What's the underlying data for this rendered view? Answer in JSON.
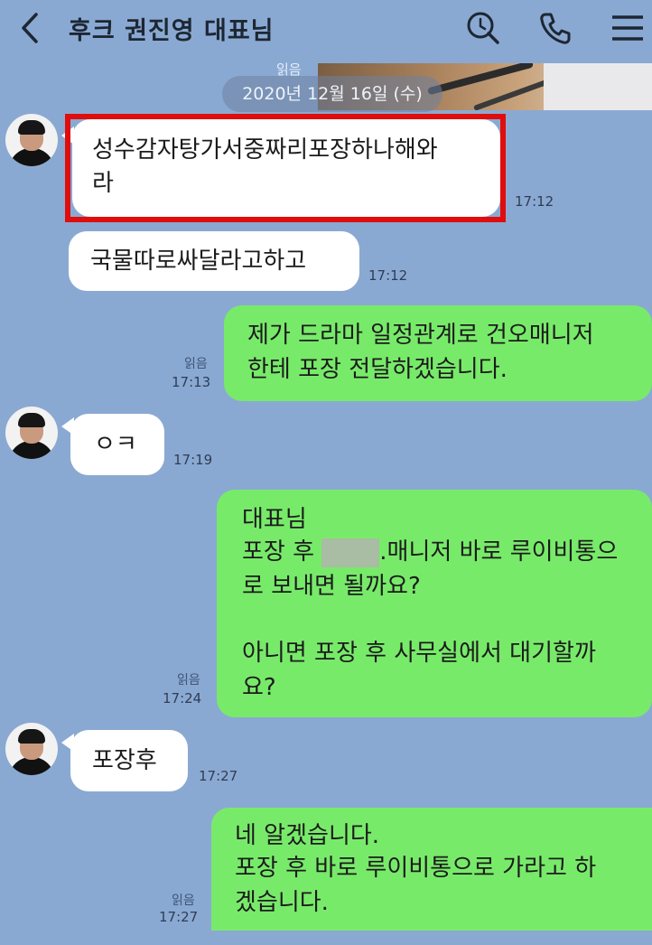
{
  "header": {
    "title": "후크 권진영 대표님"
  },
  "date": {
    "read_label": "읽음",
    "divider": "2020년 12월 16일 (수)"
  },
  "messages": [
    {
      "side": "left",
      "lines": [
        "성수감자탕가서중짜리포장하나해와",
        "라"
      ],
      "time": "17:12",
      "highlighted": true
    },
    {
      "side": "left",
      "lines": [
        "국물따로싸달라고하고"
      ],
      "time": "17:12"
    },
    {
      "side": "right",
      "lines": [
        "제가 드라마 일정관계로 건오매니저",
        "한테 포장 전달하겠습니다."
      ],
      "read": "읽음",
      "time": "17:13"
    },
    {
      "side": "left",
      "lines": [
        "ㅇㅋ"
      ],
      "time": "17:19"
    },
    {
      "side": "right",
      "lines": [
        "대표님",
        "포장 후",
        ".매니저 바로 루이비통으",
        "로 보내면 될까요?",
        "",
        "아니면 포장 후 사무실에서 대기할까",
        "요?"
      ],
      "read": "읽음",
      "time": "17:24"
    },
    {
      "side": "left",
      "lines": [
        "포장후"
      ],
      "time": "17:27"
    },
    {
      "side": "right",
      "lines": [
        "네 알겠습니다.",
        "포장 후 바로 루이비통으로 가라고 하",
        "겠습니다."
      ],
      "read": "읽음",
      "time": "17:27"
    }
  ],
  "colors": {
    "background": "#8aa9d2",
    "bubble_out": "#78ea6a",
    "bubble_in": "#ffffff",
    "highlight": "#e00d0d"
  },
  "icons": [
    "back-arrow-icon",
    "search-icon",
    "phone-icon",
    "menu-icon"
  ]
}
